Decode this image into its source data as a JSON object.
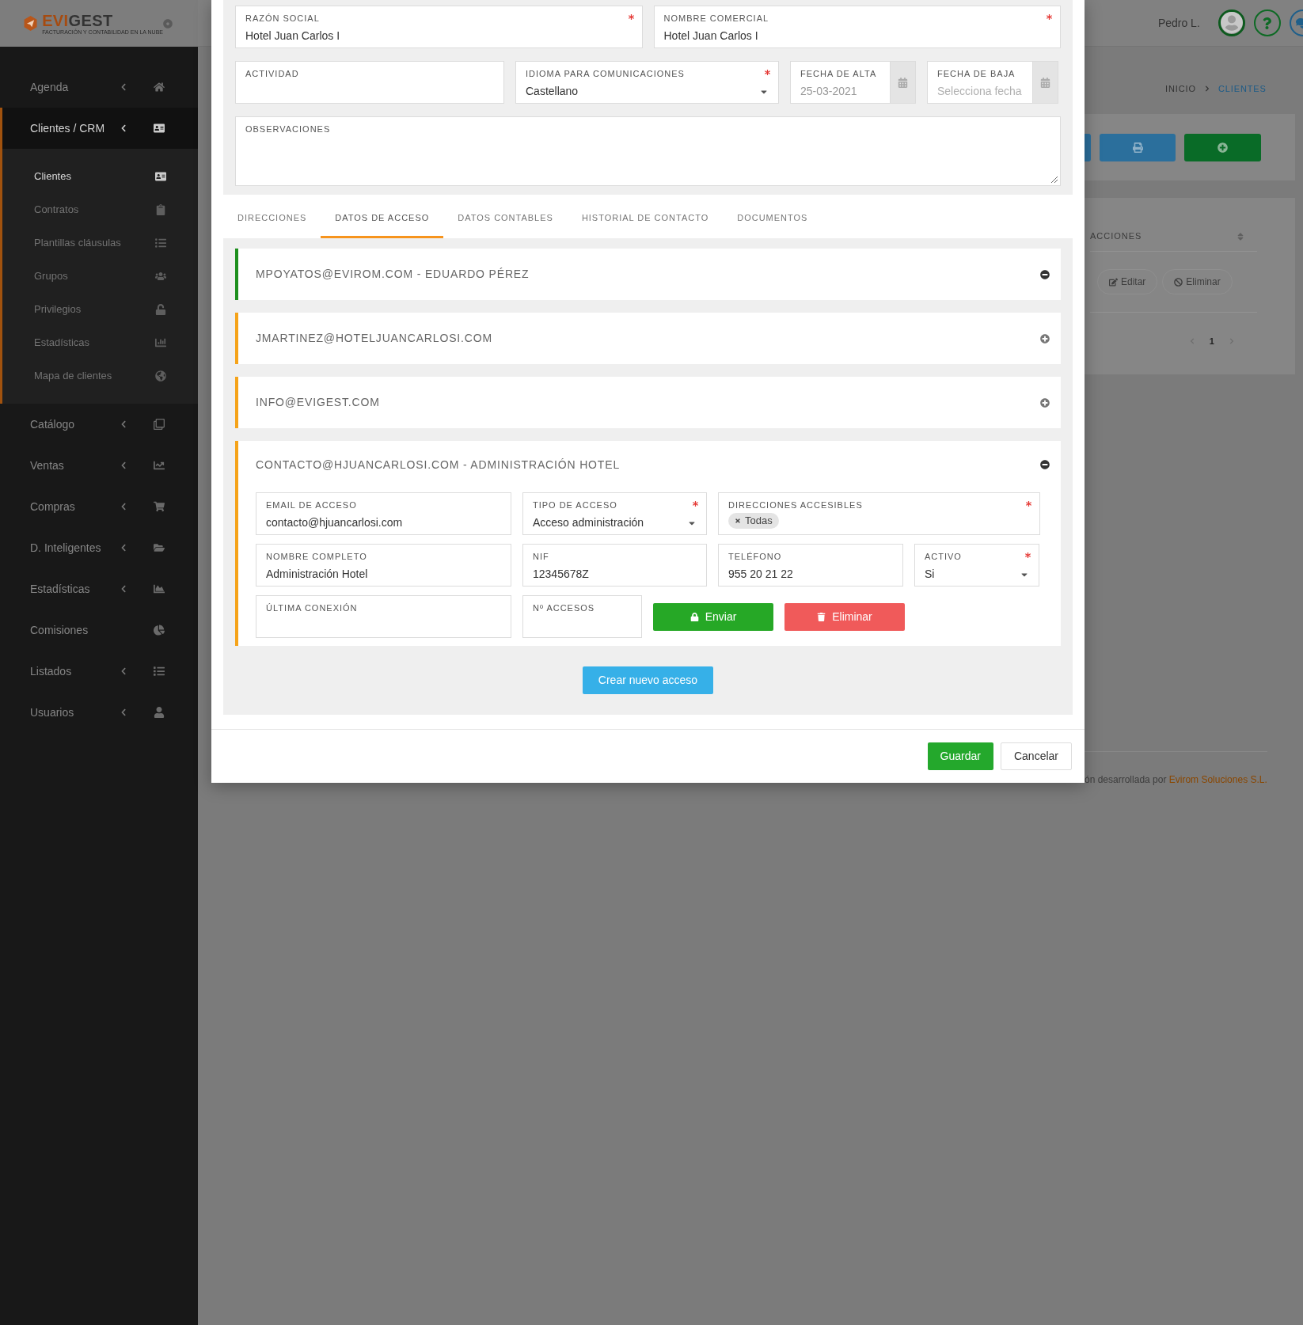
{
  "sidebar": {
    "logo": {
      "brand_first": "EVI",
      "brand_second": "GEST",
      "tagline": "FACTURACIÓN Y CONTABILIDAD EN LA NUBE"
    },
    "items": [
      {
        "label": "Agenda",
        "has_submenu": true,
        "selected": false
      },
      {
        "label": "Clientes / CRM",
        "has_submenu": true,
        "selected": true,
        "children": [
          {
            "label": "Clientes",
            "selected": true
          },
          {
            "label": "Contratos",
            "selected": false
          },
          {
            "label": "Plantillas cláusulas",
            "selected": false
          },
          {
            "label": "Grupos",
            "selected": false
          },
          {
            "label": "Privilegios",
            "selected": false
          },
          {
            "label": "Estadísticas",
            "selected": false
          },
          {
            "label": "Mapa de clientes",
            "selected": false
          }
        ]
      },
      {
        "label": "Catálogo",
        "has_submenu": true,
        "selected": false
      },
      {
        "label": "Ventas",
        "has_submenu": true,
        "selected": false
      },
      {
        "label": "Compras",
        "has_submenu": true,
        "selected": false
      },
      {
        "label": "D. Inteligentes",
        "has_submenu": true,
        "selected": false
      },
      {
        "label": "Estadísticas",
        "has_submenu": true,
        "selected": false
      },
      {
        "label": "Comisiones",
        "has_submenu": false,
        "selected": false
      },
      {
        "label": "Listados",
        "has_submenu": true,
        "selected": false
      },
      {
        "label": "Usuarios",
        "has_submenu": true,
        "selected": false
      }
    ]
  },
  "header": {
    "user_name": "Pedro L."
  },
  "breadcrumb": [
    {
      "label": "INICIO",
      "selected": false
    },
    {
      "label": "CLIENTES",
      "selected": true
    }
  ],
  "background_table": {
    "columns": [
      {
        "label": "ACCIONES"
      }
    ],
    "row_actions": [
      "Editar",
      "Eliminar"
    ],
    "pages": [
      {
        "label": "1",
        "selected": true
      }
    ]
  },
  "footer": {
    "credit": "ón desarrollada por",
    "company": "Evirom Soluciones S.L."
  },
  "modal": {
    "form_rows": [
      [
        {
          "label": "RAZÓN SOCIAL",
          "kind": "text",
          "value": "Hotel Juan Carlos I",
          "required": true
        },
        {
          "label": "NOMBRE COMERCIAL",
          "kind": "text",
          "value": "Hotel Juan Carlos I",
          "required": true
        }
      ],
      [
        {
          "label": "ACTIVIDAD",
          "kind": "text",
          "required": false
        },
        {
          "label": "IDIOMA PARA COMUNICACIONES",
          "kind": "select",
          "value": "Castellano",
          "required": true
        },
        {
          "label": "FECHA DE ALTA",
          "kind": "date",
          "value": "25-03-2021",
          "required": false
        },
        {
          "label": "FECHA DE BAJA",
          "kind": "date",
          "placeholder": "Selecciona fecha",
          "required": false
        }
      ],
      [
        {
          "label": "OBSERVACIONES",
          "kind": "textarea",
          "required": false
        }
      ]
    ],
    "tabs": [
      {
        "label": "DIRECCIONES",
        "selected": false
      },
      {
        "label": "DATOS DE ACCESO",
        "selected": true
      },
      {
        "label": "DATOS CONTABLES",
        "selected": false
      },
      {
        "label": "HISTORIAL DE CONTACTO",
        "selected": false
      },
      {
        "label": "DOCUMENTOS",
        "selected": false
      }
    ],
    "accesses": [
      {
        "title": "MPOYATOS@EVIROM.COM - EDUARDO PÉREZ",
        "color": "#1e8f1e",
        "expanded": true
      },
      {
        "title": "JMARTINEZ@HOTELJUANCARLOSI.COM",
        "color": "#f5a31a",
        "expanded": false
      },
      {
        "title": "INFO@EVIGEST.COM",
        "color": "#f5a31a",
        "expanded": false
      },
      {
        "title": "CONTACTO@HJUANCARLOSI.COM - ADMINISTRACIÓN HOTEL",
        "color": "#f5a31a",
        "expanded": true,
        "field_rows": [
          [
            {
              "label": "EMAIL DE ACCESO",
              "kind": "text",
              "value": "contacto@hjuancarlosi.com",
              "required": false
            },
            {
              "label": "TIPO DE ACCESO",
              "kind": "select",
              "value": "Acceso administración",
              "required": true
            },
            {
              "label": "DIRECCIONES ACCESIBLES",
              "kind": "tags",
              "tags": [
                "Todas"
              ],
              "required": true
            }
          ],
          [
            {
              "label": "NOMBRE COMPLETO",
              "kind": "text",
              "value": "Administración Hotel",
              "required": false
            },
            {
              "label": "NIF",
              "kind": "text",
              "value": "12345678Z",
              "required": false
            },
            {
              "label": "TELÉFONO",
              "kind": "text",
              "value": "955 20 21 22",
              "required": false
            },
            {
              "label": "ACTIVO",
              "kind": "select",
              "value": "Si",
              "required": true
            }
          ],
          [
            {
              "label": "ÚLTIMA CONEXIÓN",
              "kind": "text",
              "required": false
            },
            {
              "label": "Nº ACCESOS",
              "kind": "text",
              "required": false
            }
          ]
        ],
        "actions": [
          {
            "label": "Enviar",
            "kind": "send"
          },
          {
            "label": "Eliminar",
            "kind": "delete"
          }
        ]
      }
    ],
    "create_button": "Crear nuevo acceso",
    "footer_buttons": [
      {
        "label": "Guardar",
        "kind": "primary"
      },
      {
        "label": "Cancelar",
        "kind": "default"
      }
    ]
  }
}
